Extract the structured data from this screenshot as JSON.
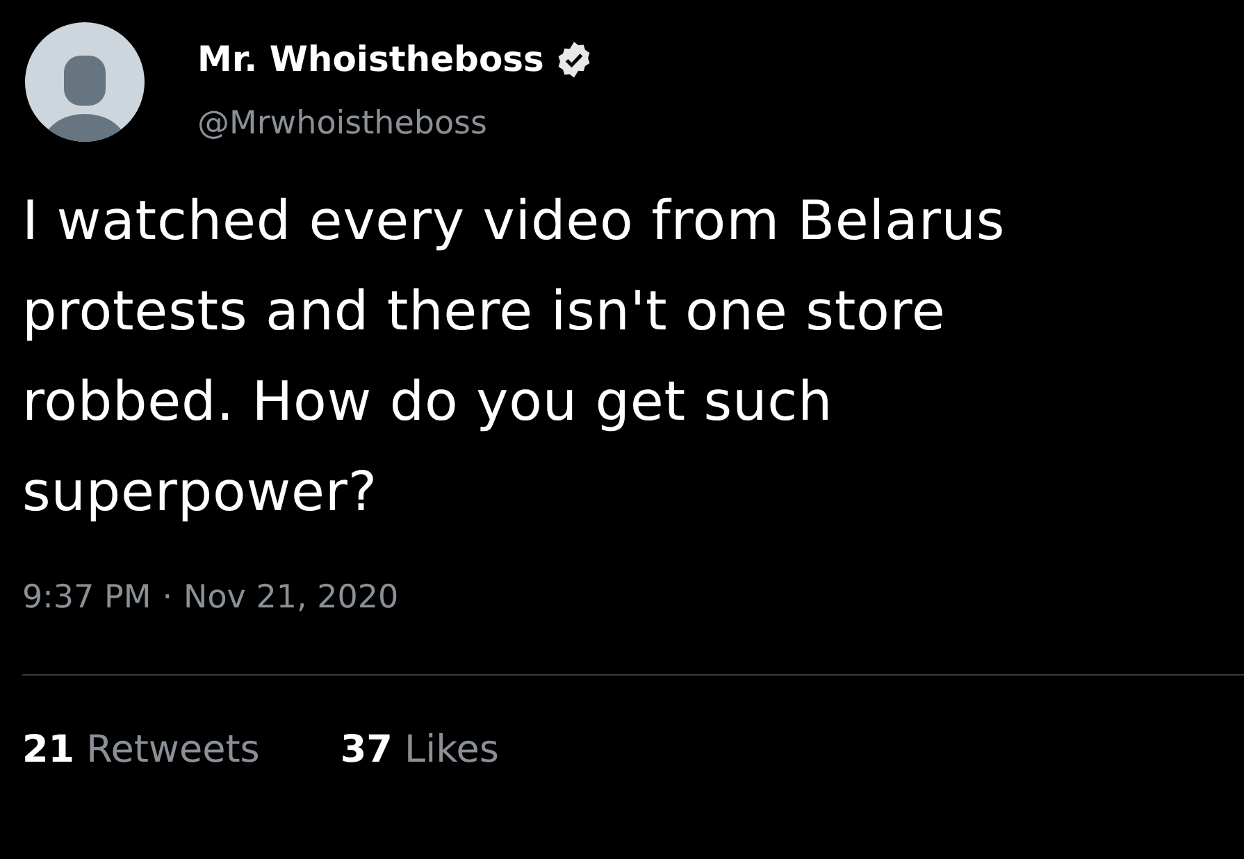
{
  "author": {
    "name": "Mr. Whoistheboss",
    "verified": true,
    "handle": "@Mrwhoistheboss"
  },
  "text": "I watched every video from Belarus protests and there isn't one store robbed. How do you get such superpower?",
  "timestamp": {
    "time": "9:37 PM",
    "separator": "·",
    "date": "Nov 21, 2020"
  },
  "stats": [
    {
      "count": "21",
      "label": "Retweets"
    },
    {
      "count": "37",
      "label": "Likes"
    }
  ]
}
